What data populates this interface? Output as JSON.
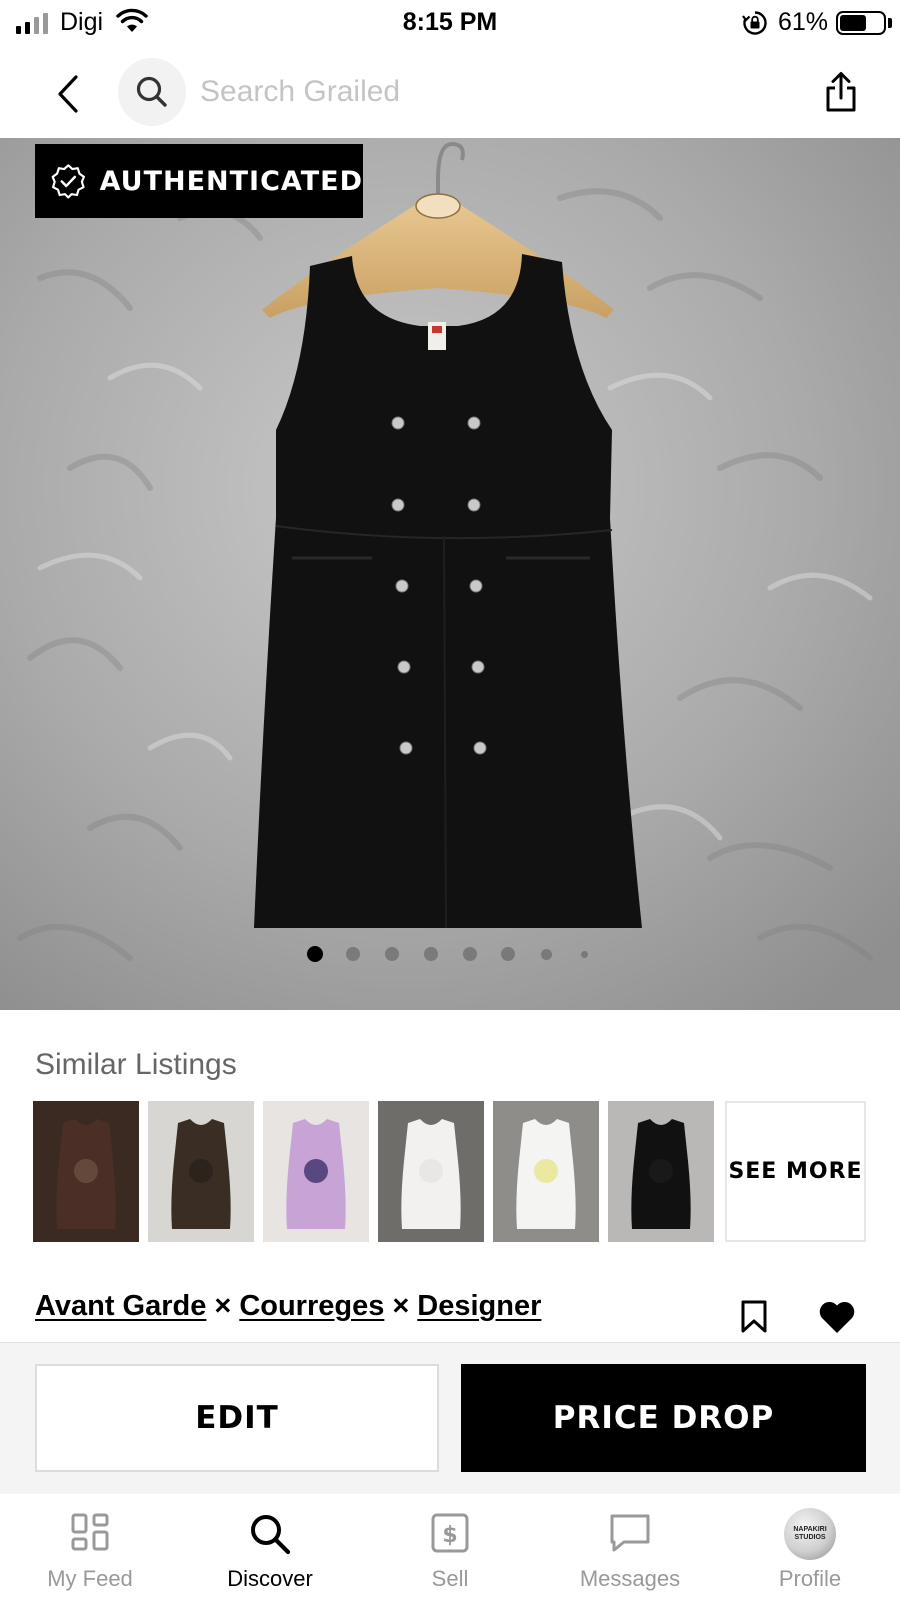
{
  "status_bar": {
    "carrier": "Digi",
    "time": "8:15 PM",
    "battery_percent": "61%",
    "battery_level": 0.61
  },
  "nav": {
    "search_placeholder": "Search Grailed"
  },
  "hero": {
    "badge_label": "AUTHENTICATED",
    "image_count": 8,
    "current_index": 0
  },
  "similar": {
    "title": "Similar Listings",
    "see_more": "SEE MORE",
    "items": [
      {
        "name": "brown-tank-top",
        "colors": [
          "#3a2a22",
          "#4b2f26",
          "#6a5040"
        ]
      },
      {
        "name": "diesel-long-sleeve",
        "colors": [
          "#d8d6d2",
          "#3a2d24",
          "#2a211b"
        ]
      },
      {
        "name": "pink-dragon-dress",
        "colors": [
          "#e7e4e2",
          "#c7a3d6",
          "#3c2f6a"
        ]
      },
      {
        "name": "white-tank-top",
        "colors": [
          "#6f6d6a",
          "#f2f1ef",
          "#e6e5e3"
        ]
      },
      {
        "name": "white-graphic-tank",
        "colors": [
          "#8f8d8a",
          "#f4f4f2",
          "#e8e58a"
        ]
      },
      {
        "name": "black-top",
        "colors": [
          "#b9b8b6",
          "#111111",
          "#1b1b1b"
        ]
      }
    ]
  },
  "listing": {
    "designers": [
      "Avant Garde",
      "Courreges",
      "Designer"
    ],
    "separator": "×"
  },
  "actions": {
    "edit": "EDIT",
    "price_drop": "PRICE DROP"
  },
  "tabs": [
    {
      "label": "My Feed",
      "icon": "feed-grid-icon"
    },
    {
      "label": "Discover",
      "icon": "search-icon",
      "active": true
    },
    {
      "label": "Sell",
      "icon": "dollar-tag-icon"
    },
    {
      "label": "Messages",
      "icon": "chat-bubble-icon"
    },
    {
      "label": "Profile",
      "icon": "avatar",
      "avatar_text": "NAPAKIRI STUDIOS"
    }
  ]
}
